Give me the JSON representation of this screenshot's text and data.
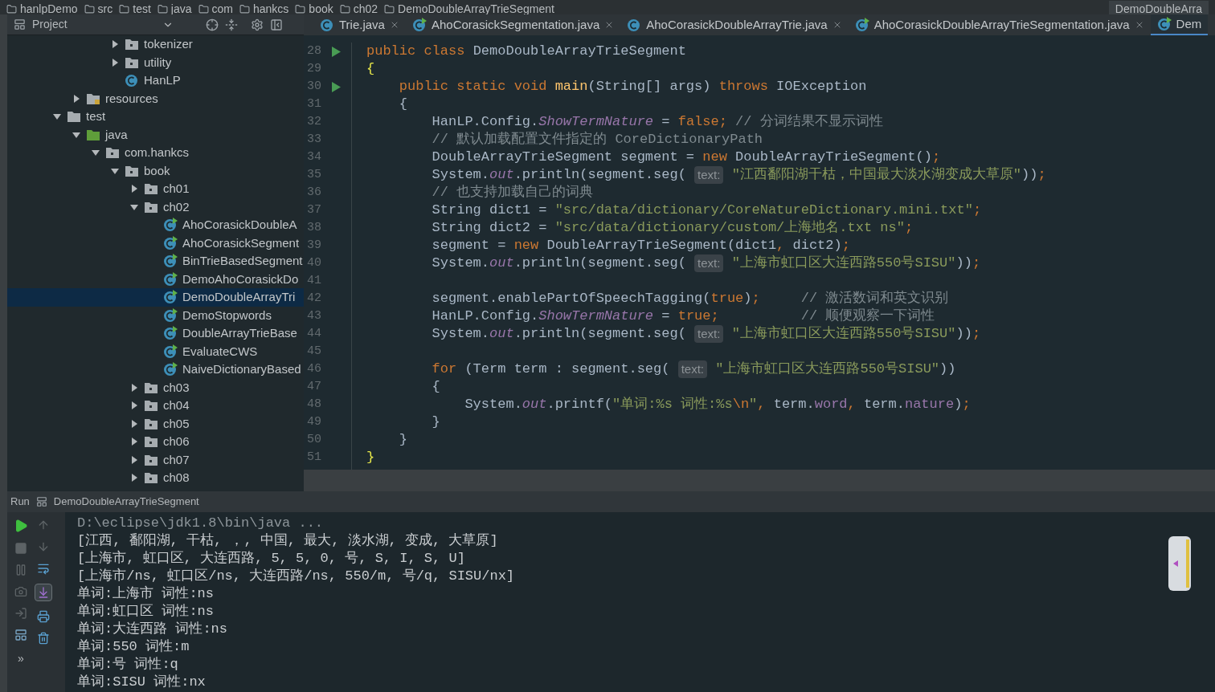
{
  "breadcrumbs": [
    "hanlpDemo",
    "src",
    "test",
    "java",
    "com",
    "hankcs",
    "book",
    "ch02",
    "DemoDoubleArrayTrieSegment"
  ],
  "run_config": "DemoDoubleArra",
  "project_panel": {
    "title": "Project"
  },
  "tree": [
    {
      "children": [
        {
          "children": [
            {
              "children": [
                {
                  "label": "tokenizer",
                  "kind": "package",
                  "expanded": false
                },
                {
                  "label": "utility",
                  "kind": "package",
                  "expanded": false
                },
                {
                  "label": "HanLP",
                  "kind": "class"
                }
              ]
            }
          ]
        },
        {
          "label": "resources",
          "kind": "resources",
          "expanded": false
        }
      ]
    },
    {
      "label": "test",
      "kind": "folder",
      "expanded": true,
      "children": [
        {
          "label": "java",
          "kind": "source",
          "expanded": true,
          "children": [
            {
              "label": "com.hankcs",
              "kind": "package",
              "expanded": true,
              "children": [
                {
                  "label": "book",
                  "kind": "package",
                  "expanded": true,
                  "children": [
                    {
                      "label": "ch01",
                      "kind": "package",
                      "expanded": false
                    },
                    {
                      "label": "ch02",
                      "kind": "package",
                      "expanded": true,
                      "children": [
                        {
                          "label": "AhoCorasickDoubleA",
                          "kind": "runnable",
                          "selected": false
                        },
                        {
                          "label": "AhoCorasickSegment",
                          "kind": "runnable",
                          "selected": false
                        },
                        {
                          "label": "BinTrieBasedSegment",
                          "kind": "runnable",
                          "selected": false
                        },
                        {
                          "label": "DemoAhoCorasickDo",
                          "kind": "runnable",
                          "selected": false
                        },
                        {
                          "label": "DemoDoubleArrayTri",
                          "kind": "runnable",
                          "selected": true
                        },
                        {
                          "label": "DemoStopwords",
                          "kind": "runnable",
                          "selected": false
                        },
                        {
                          "label": "DoubleArrayTrieBase",
                          "kind": "runnable",
                          "selected": false
                        },
                        {
                          "label": "EvaluateCWS",
                          "kind": "runnable",
                          "selected": false
                        },
                        {
                          "label": "NaiveDictionaryBased",
                          "kind": "runnable",
                          "selected": false
                        }
                      ]
                    },
                    {
                      "label": "ch03",
                      "kind": "package",
                      "expanded": false
                    },
                    {
                      "label": "ch04",
                      "kind": "package",
                      "expanded": false
                    },
                    {
                      "label": "ch05",
                      "kind": "package",
                      "expanded": false
                    },
                    {
                      "label": "ch06",
                      "kind": "package",
                      "expanded": false
                    },
                    {
                      "label": "ch07",
                      "kind": "package",
                      "expanded": false
                    },
                    {
                      "label": "ch08",
                      "kind": "package",
                      "expanded": false
                    }
                  ]
                }
              ]
            }
          ]
        }
      ]
    }
  ],
  "tabs": [
    {
      "label": "Trie.java",
      "kind": "class",
      "selected": false
    },
    {
      "label": "AhoCorasickSegmentation.java",
      "kind": "runnable",
      "selected": false
    },
    {
      "label": "AhoCorasickDoubleArrayTrie.java",
      "kind": "class",
      "selected": false
    },
    {
      "label": "AhoCorasickDoubleArrayTrieSegmentation.java",
      "kind": "runnable",
      "selected": false
    },
    {
      "label": "Dem",
      "kind": "runnable",
      "selected": true
    }
  ],
  "code": [
    {
      "number": "28",
      "run": true,
      "tokens": [
        {
          "kind": "kw",
          "text": "public class "
        },
        {
          "kind": "plain",
          "text": "DemoDoubleArrayTrieSegment"
        }
      ]
    },
    {
      "number": "29",
      "run": false,
      "tokens": [
        {
          "kind": "brace",
          "text": "{"
        }
      ]
    },
    {
      "number": "30",
      "run": true,
      "tokens": [
        {
          "kind": "kw",
          "text": "    public static void "
        },
        {
          "kind": "method",
          "text": "main"
        },
        {
          "kind": "plain",
          "text": "(String[] args) "
        },
        {
          "kind": "kw",
          "text": "throws "
        },
        {
          "kind": "plain",
          "text": "IOException"
        }
      ]
    },
    {
      "number": "31",
      "run": false,
      "tokens": [
        {
          "kind": "plain",
          "text": "    {"
        }
      ]
    },
    {
      "number": "32",
      "run": false,
      "tokens": [
        {
          "kind": "plain",
          "text": "        HanLP.Config."
        },
        {
          "kind": "italic",
          "text": "ShowTermNature"
        },
        {
          "kind": "plain",
          "text": " = "
        },
        {
          "kind": "kw",
          "text": "false;"
        },
        {
          "kind": "comment",
          "text": " // 分词结果不显示词性"
        }
      ]
    },
    {
      "number": "33",
      "run": false,
      "tokens": [
        {
          "kind": "comment",
          "text": "        // 默认加载配置文件指定的 CoreDictionaryPath"
        }
      ]
    },
    {
      "number": "34",
      "run": false,
      "tokens": [
        {
          "kind": "plain",
          "text": "        DoubleArrayTrieSegment segment = "
        },
        {
          "kind": "kw",
          "text": "new "
        },
        {
          "kind": "plain",
          "text": "DoubleArrayTrieSegment()"
        },
        {
          "kind": "kw",
          "text": ";"
        }
      ]
    },
    {
      "number": "35",
      "run": false,
      "tokens": [
        {
          "kind": "plain",
          "text": "        System."
        },
        {
          "kind": "italic",
          "text": "out"
        },
        {
          "kind": "plain",
          "text": ".println(segment.seg( "
        },
        {
          "kind": "hint",
          "text": "text:"
        },
        {
          "kind": "string",
          "text": " \"江西鄱阳湖干枯，中国最大淡水湖变成大草原\""
        },
        {
          "kind": "plain",
          "text": "))"
        },
        {
          "kind": "kw",
          "text": ";"
        }
      ]
    },
    {
      "number": "36",
      "run": false,
      "tokens": [
        {
          "kind": "comment",
          "text": "        // 也支持加载自己的词典"
        }
      ]
    },
    {
      "number": "37",
      "run": false,
      "tokens": [
        {
          "kind": "plain",
          "text": "        String dict1 = "
        },
        {
          "kind": "string",
          "text": "\"src/data/dictionary/CoreNatureDictionary.mini.txt\""
        },
        {
          "kind": "kw",
          "text": ";"
        }
      ]
    },
    {
      "number": "38",
      "run": false,
      "tokens": [
        {
          "kind": "plain",
          "text": "        String dict2 = "
        },
        {
          "kind": "string",
          "text": "\"src/data/dictionary/custom/上海地名.txt ns\""
        },
        {
          "kind": "kw",
          "text": ";"
        }
      ]
    },
    {
      "number": "39",
      "run": false,
      "tokens": [
        {
          "kind": "plain",
          "text": "        segment = "
        },
        {
          "kind": "kw",
          "text": "new "
        },
        {
          "kind": "plain",
          "text": "DoubleArrayTrieSegment(dict1"
        },
        {
          "kind": "kw",
          "text": ","
        },
        {
          "kind": "plain",
          "text": " dict2)"
        },
        {
          "kind": "kw",
          "text": ";"
        }
      ]
    },
    {
      "number": "40",
      "run": false,
      "tokens": [
        {
          "kind": "plain",
          "text": "        System."
        },
        {
          "kind": "italic",
          "text": "out"
        },
        {
          "kind": "plain",
          "text": ".println(segment.seg( "
        },
        {
          "kind": "hint",
          "text": "text:"
        },
        {
          "kind": "string",
          "text": " \"上海市虹口区大连西路550号SISU\""
        },
        {
          "kind": "plain",
          "text": "))"
        },
        {
          "kind": "kw",
          "text": ";"
        }
      ]
    },
    {
      "number": "41",
      "run": false
    },
    {
      "number": "42",
      "run": false,
      "tokens": [
        {
          "kind": "plain",
          "text": "        segment.enablePartOfSpeechTagging("
        },
        {
          "kind": "kw",
          "text": "true"
        },
        {
          "kind": "plain",
          "text": ")"
        },
        {
          "kind": "kw",
          "text": ";"
        },
        {
          "kind": "comment",
          "text": "     // 激活数词和英文识别"
        }
      ]
    },
    {
      "number": "43",
      "run": false,
      "tokens": [
        {
          "kind": "plain",
          "text": "        HanLP.Config."
        },
        {
          "kind": "italic",
          "text": "ShowTermNature"
        },
        {
          "kind": "plain",
          "text": " = "
        },
        {
          "kind": "kw",
          "text": "true;"
        },
        {
          "kind": "comment",
          "text": "          // 顺便观察一下词性"
        }
      ]
    },
    {
      "number": "44",
      "run": false,
      "tokens": [
        {
          "kind": "plain",
          "text": "        System."
        },
        {
          "kind": "italic",
          "text": "out"
        },
        {
          "kind": "plain",
          "text": ".println(segment.seg( "
        },
        {
          "kind": "hint",
          "text": "text:"
        },
        {
          "kind": "string",
          "text": " \"上海市虹口区大连西路550号SISU\""
        },
        {
          "kind": "plain",
          "text": "))"
        },
        {
          "kind": "kw",
          "text": ";"
        }
      ]
    },
    {
      "number": "45",
      "run": false
    },
    {
      "number": "46",
      "run": false,
      "tokens": [
        {
          "kind": "kw",
          "text": "        for "
        },
        {
          "kind": "plain",
          "text": "(Term term : segment.seg( "
        },
        {
          "kind": "hint",
          "text": "text:"
        },
        {
          "kind": "string",
          "text": " \"上海市虹口区大连西路550号SISU\""
        },
        {
          "kind": "plain",
          "text": "))"
        }
      ]
    },
    {
      "number": "47",
      "run": false,
      "tokens": [
        {
          "kind": "plain",
          "text": "        {"
        }
      ]
    },
    {
      "number": "48",
      "run": false,
      "tokens": [
        {
          "kind": "plain",
          "text": "            System."
        },
        {
          "kind": "italic",
          "text": "out"
        },
        {
          "kind": "plain",
          "text": ".printf("
        },
        {
          "kind": "string",
          "text": "\"单词:%s 词性:%s"
        },
        {
          "kind": "kw",
          "text": "\\n"
        },
        {
          "kind": "string",
          "text": "\""
        },
        {
          "kind": "kw",
          "text": ", "
        },
        {
          "kind": "plain",
          "text": "term."
        },
        {
          "kind": "field",
          "text": "word"
        },
        {
          "kind": "kw",
          "text": ", "
        },
        {
          "kind": "plain",
          "text": "term."
        },
        {
          "kind": "field",
          "text": "nature"
        },
        {
          "kind": "plain",
          "text": ")"
        },
        {
          "kind": "kw",
          "text": ";"
        }
      ]
    },
    {
      "number": "49",
      "run": false,
      "tokens": [
        {
          "kind": "plain",
          "text": "        }"
        }
      ]
    },
    {
      "number": "50",
      "run": false,
      "tokens": [
        {
          "kind": "plain",
          "text": "    }"
        }
      ]
    },
    {
      "number": "51",
      "run": false,
      "tokens": [
        {
          "kind": "brace",
          "text": "}"
        }
      ]
    }
  ],
  "run_panel": {
    "label": "Run",
    "config": "DemoDoubleArrayTrieSegment"
  },
  "console": [
    {
      "kind": "command",
      "text": "D:\\eclipse\\jdk1.8\\bin\\java ..."
    },
    {
      "kind": "output",
      "text": "[江西, 鄱阳湖, 干枯, ，, 中国, 最大, 淡水湖, 变成, 大草原]"
    },
    {
      "kind": "output",
      "text": "[上海市, 虹口区, 大连西路, 5, 5, 0, 号, S, I, S, U]"
    },
    {
      "kind": "output",
      "text": "[上海市/ns, 虹口区/ns, 大连西路/ns, 550/m, 号/q, SISU/nx]"
    },
    {
      "kind": "output",
      "text": "单词:上海市 词性:ns"
    },
    {
      "kind": "output",
      "text": "单词:虹口区 词性:ns"
    },
    {
      "kind": "output",
      "text": "单词:大连西路 词性:ns"
    },
    {
      "kind": "output",
      "text": "单词:550 词性:m"
    },
    {
      "kind": "output",
      "text": "单词:号 词性:q"
    },
    {
      "kind": "output",
      "text": "单词:SISU 词性:nx"
    }
  ],
  "more_tools": "»"
}
